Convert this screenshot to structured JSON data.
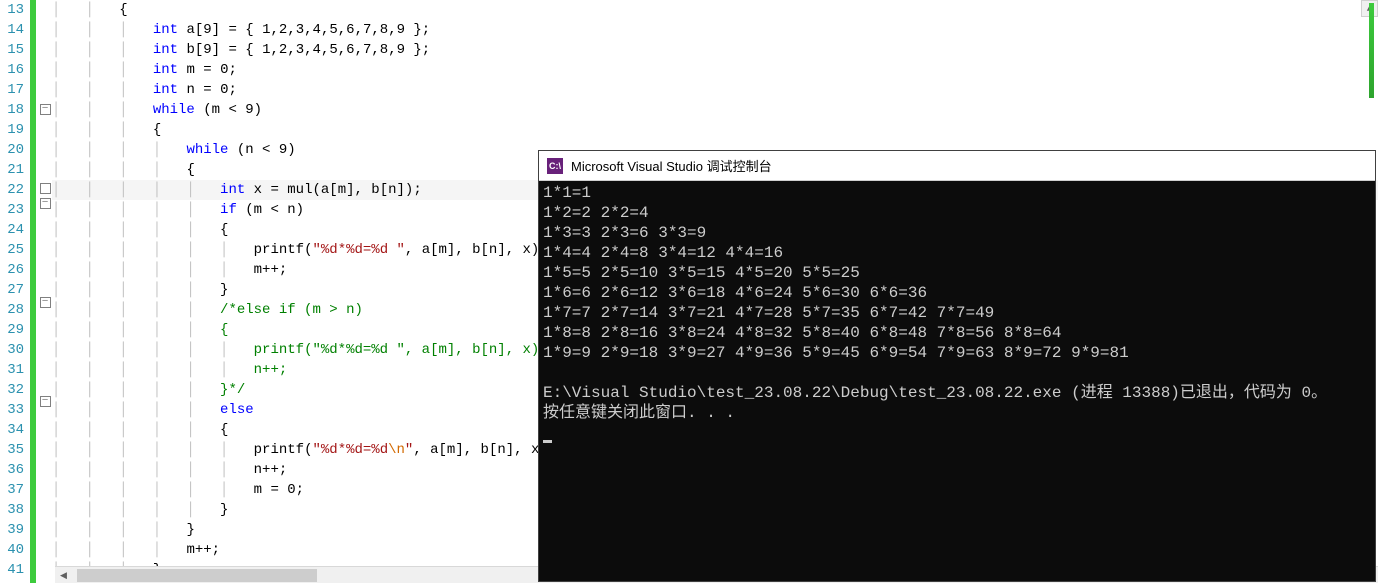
{
  "editor": {
    "first_line": 13,
    "last_line": 41,
    "highlighted_line": 22,
    "fold_markers": {
      "18": "−",
      "22": " ",
      "23": "−",
      "28": "−",
      "33": "−"
    },
    "lines": [
      {
        "n": 13,
        "indent": 2,
        "tokens": [
          {
            "t": "{",
            "c": "brace"
          }
        ]
      },
      {
        "n": 14,
        "indent": 3,
        "tokens": [
          {
            "t": "int",
            "c": "type"
          },
          {
            "t": " a[",
            "c": "punc"
          },
          {
            "t": "9",
            "c": "num"
          },
          {
            "t": "] = { ",
            "c": "punc"
          },
          {
            "t": "1",
            "c": "num"
          },
          {
            "t": ",",
            "c": "punc"
          },
          {
            "t": "2",
            "c": "num"
          },
          {
            "t": ",",
            "c": "punc"
          },
          {
            "t": "3",
            "c": "num"
          },
          {
            "t": ",",
            "c": "punc"
          },
          {
            "t": "4",
            "c": "num"
          },
          {
            "t": ",",
            "c": "punc"
          },
          {
            "t": "5",
            "c": "num"
          },
          {
            "t": ",",
            "c": "punc"
          },
          {
            "t": "6",
            "c": "num"
          },
          {
            "t": ",",
            "c": "punc"
          },
          {
            "t": "7",
            "c": "num"
          },
          {
            "t": ",",
            "c": "punc"
          },
          {
            "t": "8",
            "c": "num"
          },
          {
            "t": ",",
            "c": "punc"
          },
          {
            "t": "9",
            "c": "num"
          },
          {
            "t": " };",
            "c": "punc"
          }
        ]
      },
      {
        "n": 15,
        "indent": 3,
        "tokens": [
          {
            "t": "int",
            "c": "type"
          },
          {
            "t": " b[",
            "c": "punc"
          },
          {
            "t": "9",
            "c": "num"
          },
          {
            "t": "] = { ",
            "c": "punc"
          },
          {
            "t": "1",
            "c": "num"
          },
          {
            "t": ",",
            "c": "punc"
          },
          {
            "t": "2",
            "c": "num"
          },
          {
            "t": ",",
            "c": "punc"
          },
          {
            "t": "3",
            "c": "num"
          },
          {
            "t": ",",
            "c": "punc"
          },
          {
            "t": "4",
            "c": "num"
          },
          {
            "t": ",",
            "c": "punc"
          },
          {
            "t": "5",
            "c": "num"
          },
          {
            "t": ",",
            "c": "punc"
          },
          {
            "t": "6",
            "c": "num"
          },
          {
            "t": ",",
            "c": "punc"
          },
          {
            "t": "7",
            "c": "num"
          },
          {
            "t": ",",
            "c": "punc"
          },
          {
            "t": "8",
            "c": "num"
          },
          {
            "t": ",",
            "c": "punc"
          },
          {
            "t": "9",
            "c": "num"
          },
          {
            "t": " };",
            "c": "punc"
          }
        ]
      },
      {
        "n": 16,
        "indent": 3,
        "tokens": [
          {
            "t": "int",
            "c": "type"
          },
          {
            "t": " m = ",
            "c": "punc"
          },
          {
            "t": "0",
            "c": "num"
          },
          {
            "t": ";",
            "c": "punc"
          }
        ]
      },
      {
        "n": 17,
        "indent": 3,
        "tokens": [
          {
            "t": "int",
            "c": "type"
          },
          {
            "t": " n = ",
            "c": "punc"
          },
          {
            "t": "0",
            "c": "num"
          },
          {
            "t": ";",
            "c": "punc"
          }
        ]
      },
      {
        "n": 18,
        "indent": 3,
        "tokens": [
          {
            "t": "while",
            "c": "kw"
          },
          {
            "t": " (m < ",
            "c": "punc"
          },
          {
            "t": "9",
            "c": "num"
          },
          {
            "t": ")",
            "c": "punc"
          }
        ]
      },
      {
        "n": 19,
        "indent": 3,
        "tokens": [
          {
            "t": "{",
            "c": "brace"
          }
        ]
      },
      {
        "n": 20,
        "indent": 4,
        "tokens": [
          {
            "t": "while",
            "c": "kw"
          },
          {
            "t": " (n < ",
            "c": "punc"
          },
          {
            "t": "9",
            "c": "num"
          },
          {
            "t": ")",
            "c": "punc"
          }
        ]
      },
      {
        "n": 21,
        "indent": 4,
        "tokens": [
          {
            "t": "{",
            "c": "brace"
          }
        ]
      },
      {
        "n": 22,
        "indent": 5,
        "tokens": [
          {
            "t": "int",
            "c": "type"
          },
          {
            "t": " x = ",
            "c": "punc"
          },
          {
            "t": "mul",
            "c": "fn"
          },
          {
            "t": "(a[m], b[n]);",
            "c": "punc"
          }
        ]
      },
      {
        "n": 23,
        "indent": 5,
        "tokens": [
          {
            "t": "if",
            "c": "kw"
          },
          {
            "t": " (m < n)",
            "c": "punc"
          }
        ]
      },
      {
        "n": 24,
        "indent": 5,
        "tokens": [
          {
            "t": "{",
            "c": "brace"
          }
        ]
      },
      {
        "n": 25,
        "indent": 6,
        "tokens": [
          {
            "t": "printf",
            "c": "fn"
          },
          {
            "t": "(",
            "c": "punc"
          },
          {
            "t": "\"%d*%d=%d \"",
            "c": "str"
          },
          {
            "t": ", a[m], b[n], x);",
            "c": "punc"
          }
        ]
      },
      {
        "n": 26,
        "indent": 6,
        "tokens": [
          {
            "t": "m++;",
            "c": "punc"
          }
        ]
      },
      {
        "n": 27,
        "indent": 5,
        "tokens": [
          {
            "t": "}",
            "c": "brace"
          }
        ]
      },
      {
        "n": 28,
        "indent": 5,
        "tokens": [
          {
            "t": "/*else if (m > n)",
            "c": "cmt"
          }
        ]
      },
      {
        "n": 29,
        "indent": 5,
        "tokens": [
          {
            "t": "{",
            "c": "cmt"
          }
        ]
      },
      {
        "n": 30,
        "indent": 6,
        "tokens": [
          {
            "t": "printf(\"%d*%d=%d \", a[m], b[n], x);",
            "c": "cmt"
          }
        ]
      },
      {
        "n": 31,
        "indent": 6,
        "tokens": [
          {
            "t": "n++;",
            "c": "cmt"
          }
        ]
      },
      {
        "n": 32,
        "indent": 5,
        "tokens": [
          {
            "t": "}*/",
            "c": "cmt"
          }
        ]
      },
      {
        "n": 33,
        "indent": 5,
        "tokens": [
          {
            "t": "else",
            "c": "kw"
          }
        ]
      },
      {
        "n": 34,
        "indent": 5,
        "tokens": [
          {
            "t": "{",
            "c": "brace"
          }
        ]
      },
      {
        "n": 35,
        "indent": 6,
        "tokens": [
          {
            "t": "printf",
            "c": "fn"
          },
          {
            "t": "(",
            "c": "punc"
          },
          {
            "t": "\"%d*%d=%d",
            "c": "str"
          },
          {
            "t": "\\n",
            "c": "esc"
          },
          {
            "t": "\"",
            "c": "str"
          },
          {
            "t": ", a[m], b[n], x);",
            "c": "punc"
          }
        ]
      },
      {
        "n": 36,
        "indent": 6,
        "tokens": [
          {
            "t": "n++;",
            "c": "punc"
          }
        ]
      },
      {
        "n": 37,
        "indent": 6,
        "tokens": [
          {
            "t": "m = ",
            "c": "punc"
          },
          {
            "t": "0",
            "c": "num"
          },
          {
            "t": ";",
            "c": "punc"
          }
        ]
      },
      {
        "n": 38,
        "indent": 5,
        "tokens": [
          {
            "t": "}",
            "c": "brace"
          }
        ]
      },
      {
        "n": 39,
        "indent": 4,
        "tokens": [
          {
            "t": "}",
            "c": "brace"
          }
        ]
      },
      {
        "n": 40,
        "indent": 4,
        "tokens": [
          {
            "t": "m++;",
            "c": "punc"
          }
        ]
      },
      {
        "n": 41,
        "indent": 3,
        "tokens": [
          {
            "t": "}",
            "c": "brace"
          }
        ]
      }
    ]
  },
  "console": {
    "title": "Microsoft Visual Studio 调试控制台",
    "icon_text": "C:\\",
    "output_lines": [
      "1*1=1",
      "1*2=2 2*2=4",
      "1*3=3 2*3=6 3*3=9",
      "1*4=4 2*4=8 3*4=12 4*4=16",
      "1*5=5 2*5=10 3*5=15 4*5=20 5*5=25",
      "1*6=6 2*6=12 3*6=18 4*6=24 5*6=30 6*6=36",
      "1*7=7 2*7=14 3*7=21 4*7=28 5*7=35 6*7=42 7*7=49",
      "1*8=8 2*8=16 3*8=24 4*8=32 5*8=40 6*8=48 7*8=56 8*8=64",
      "1*9=9 2*9=18 3*9=27 4*9=36 5*9=45 6*9=54 7*9=63 8*9=72 9*9=81",
      "",
      "E:\\Visual Studio\\test_23.08.22\\Debug\\test_23.08.22.exe (进程 13388)已退出，代码为 0。",
      "按任意键关闭此窗口. . ."
    ]
  }
}
